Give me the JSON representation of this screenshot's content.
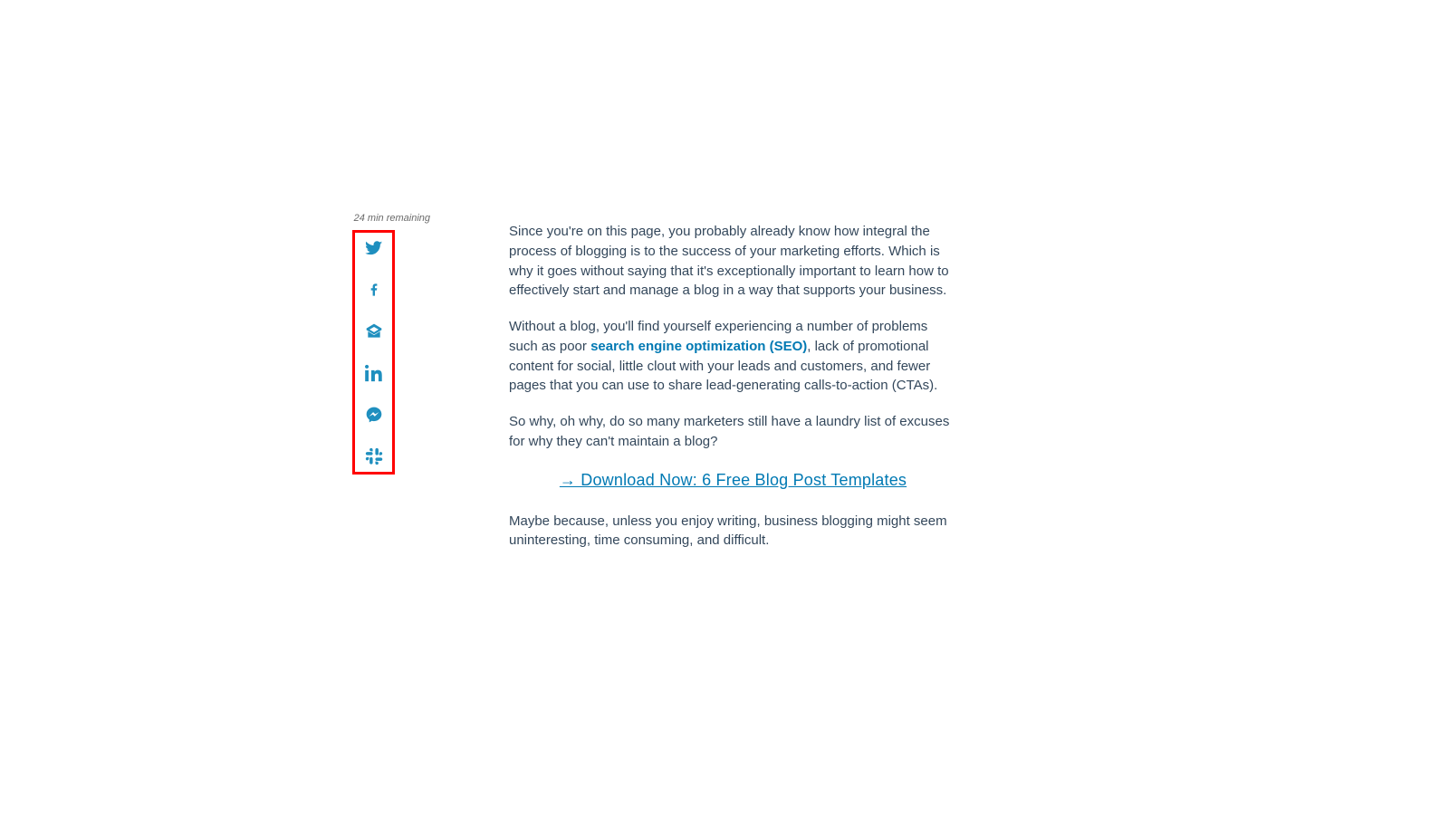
{
  "reading_time": "24 min remaining",
  "share": {
    "items": [
      {
        "name": "twitter",
        "label": "Share on Twitter"
      },
      {
        "name": "facebook",
        "label": "Share on Facebook"
      },
      {
        "name": "email",
        "label": "Share via Email"
      },
      {
        "name": "linkedin",
        "label": "Share on LinkedIn"
      },
      {
        "name": "messenger",
        "label": "Share on Messenger"
      },
      {
        "name": "slack",
        "label": "Share on Slack"
      }
    ]
  },
  "article": {
    "p1": "Since you're on this page, you probably already know how integral the process of blogging is to the success of your marketing efforts. Which is why it goes without saying that it's exceptionally important to learn how to effectively start and manage a blog in a way that supports your business.",
    "p2_pre": "Without a blog, you'll find yourself experiencing a number of problems such as poor ",
    "p2_link": "search engine optimization (SEO)",
    "p2_post": ", lack of promotional content for social, little clout with your leads and customers, and fewer pages that you can use to share lead-generating calls-to-action (CTAs).",
    "p3": "So why, oh why, do so many marketers still have a laundry list of excuses for why they can't maintain a blog?",
    "cta": "→ Download Now: 6 Free Blog Post Templates",
    "p4": "Maybe because, unless you enjoy writing, business blogging might seem uninteresting, time consuming, and difficult."
  },
  "colors": {
    "accent": "#0079b3",
    "highlight_border": "#ff0000",
    "body_text": "#33475b"
  }
}
